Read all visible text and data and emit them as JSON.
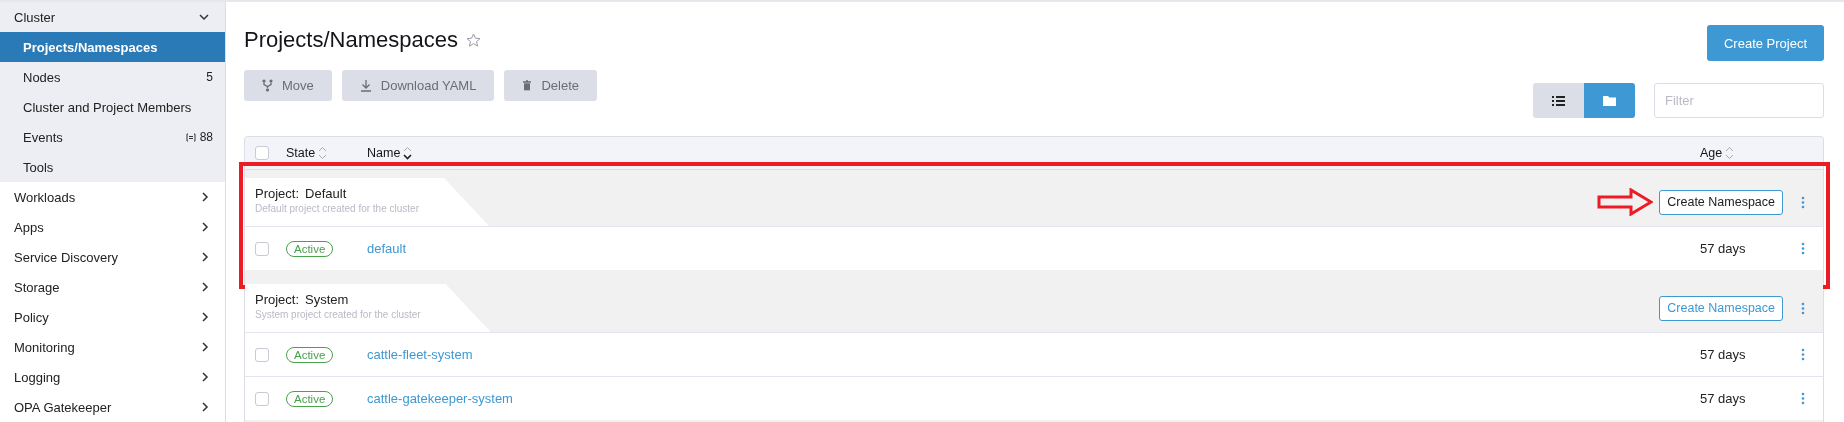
{
  "sidebar": {
    "groups": [
      {
        "label": "Cluster",
        "expanded": true,
        "items": [
          {
            "label": "Projects/Namespaces",
            "selected": true
          },
          {
            "label": "Nodes",
            "count": "5",
            "selected": false
          },
          {
            "label": "Cluster and Project Members",
            "selected": false
          },
          {
            "label": "Events",
            "count": "88",
            "count_icon": true,
            "selected": false
          },
          {
            "label": "Tools",
            "selected": false
          }
        ]
      },
      {
        "label": "Workloads",
        "expanded": false
      },
      {
        "label": "Apps",
        "expanded": false
      },
      {
        "label": "Service Discovery",
        "expanded": false
      },
      {
        "label": "Storage",
        "expanded": false
      },
      {
        "label": "Policy",
        "expanded": false
      },
      {
        "label": "Monitoring",
        "expanded": false
      },
      {
        "label": "Logging",
        "expanded": false
      },
      {
        "label": "OPA Gatekeeper",
        "expanded": false
      }
    ]
  },
  "page": {
    "title": "Projects/Namespaces",
    "favorite": false,
    "primary_button": "Create Project"
  },
  "toolbar": [
    {
      "label": "Move",
      "kind": "move",
      "disabled": true
    },
    {
      "label": "Download YAML",
      "kind": "download",
      "disabled": true
    },
    {
      "label": "Delete",
      "kind": "delete",
      "disabled": true
    }
  ],
  "view_toggle": [
    {
      "kind": "list",
      "selected": false
    },
    {
      "kind": "folder",
      "selected": true
    }
  ],
  "filter": {
    "placeholder": "Filter"
  },
  "table": {
    "all_checked": false,
    "columns": [
      {
        "label": "State",
        "sorted": false
      },
      {
        "label": "Name",
        "sorted": true
      },
      {
        "label": "Age",
        "sorted": false
      }
    ],
    "groups": [
      {
        "label": "Project:",
        "name": "Default",
        "description": "Default project created for the cluster",
        "button": "Create Namespace",
        "hovered": true,
        "highlighted": true,
        "rows": [
          {
            "checked": false,
            "state": "Active",
            "name": "default",
            "age": "57 days"
          }
        ]
      },
      {
        "label": "Project:",
        "name": "System",
        "description": "System project created for the cluster",
        "button": "Create Namespace",
        "hovered": false,
        "highlighted": false,
        "rows": [
          {
            "checked": false,
            "state": "Active",
            "name": "cattle-fleet-system",
            "age": "57 days"
          },
          {
            "checked": false,
            "state": "Active",
            "name": "cattle-gatekeeper-system",
            "age": "57 days"
          }
        ]
      }
    ]
  }
}
